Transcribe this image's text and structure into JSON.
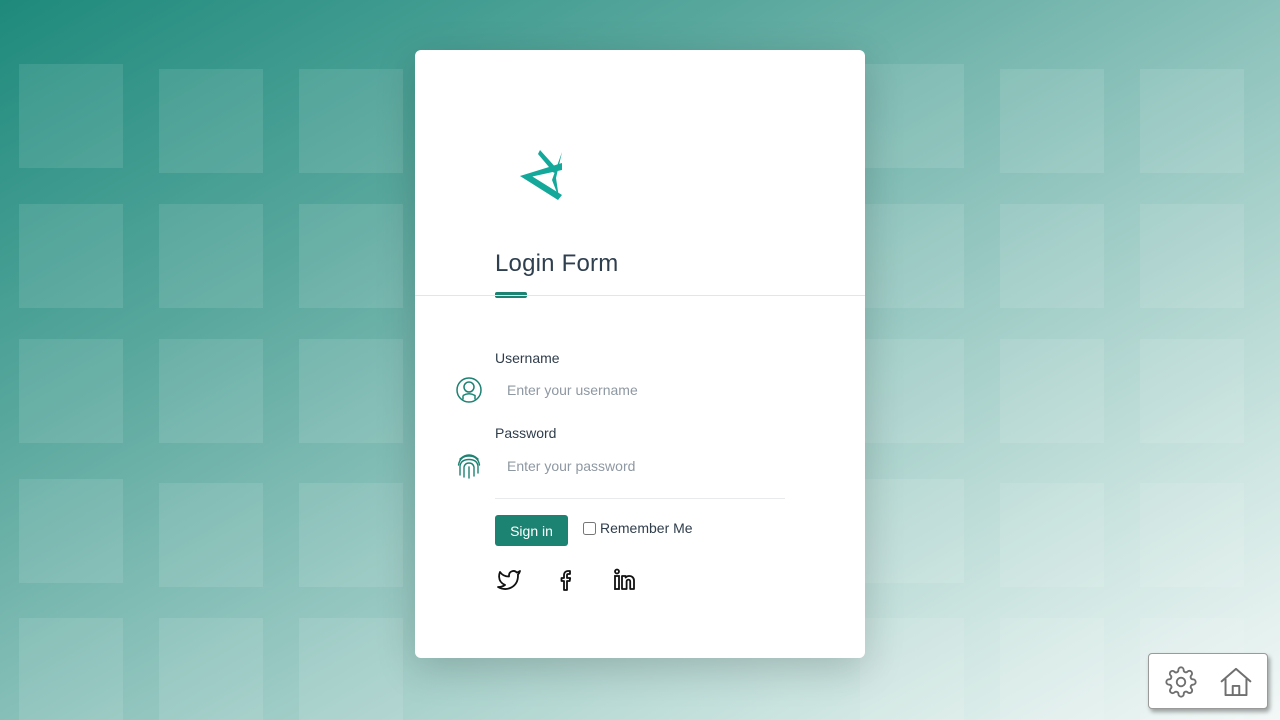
{
  "login": {
    "title": "Login Form",
    "logo": "brand-logo",
    "username": {
      "label": "Username",
      "placeholder": "Enter your username",
      "value": "",
      "icon": "user-icon"
    },
    "password": {
      "label": "Password",
      "placeholder": "Enter your password",
      "value": "",
      "icon": "fingerprint-icon"
    },
    "signin_label": "Sign in",
    "remember_label": "Remember Me",
    "remember_checked": false,
    "social": [
      "twitter-icon",
      "facebook-icon",
      "linkedin-icon"
    ]
  },
  "toolbar": {
    "icons": [
      "gear-icon",
      "home-icon"
    ]
  },
  "colors": {
    "accent": "#1c8272",
    "logo": "#13a89a",
    "title_text": "#2e3f4f",
    "background_start": "#1e8a7c",
    "background_end": "#f2f8f7"
  }
}
